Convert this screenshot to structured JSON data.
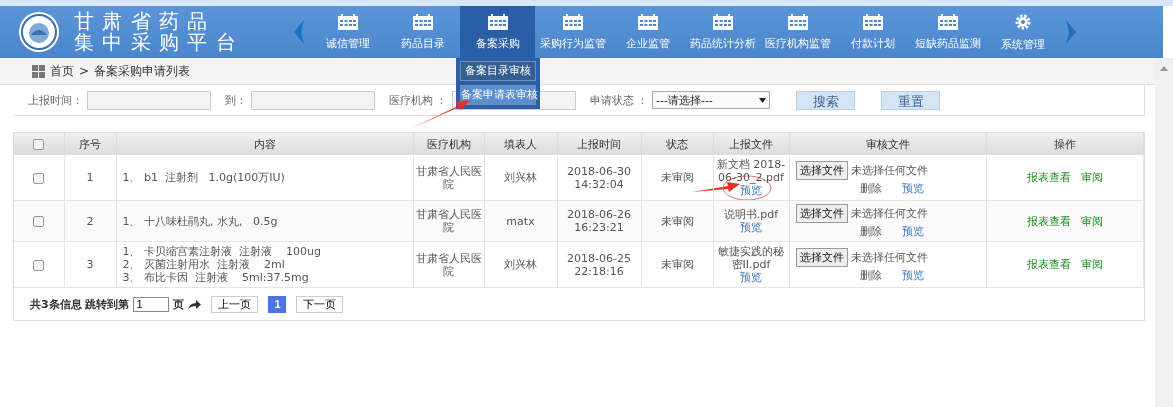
{
  "header": {
    "title_lines": [
      "甘 肃 省 药 品",
      "集 中 采 购 平 台"
    ],
    "nav": [
      {
        "label": "诚信管理",
        "kind": "calendar",
        "selected": false
      },
      {
        "label": "药品目录",
        "kind": "calendar",
        "selected": false
      },
      {
        "label": "备案采购",
        "kind": "calendar",
        "selected": true
      },
      {
        "label": "采购行为监管",
        "kind": "calendar",
        "selected": false
      },
      {
        "label": "企业监管",
        "kind": "calendar",
        "selected": false
      },
      {
        "label": "药品统计分析",
        "kind": "calendar",
        "selected": false
      },
      {
        "label": "医疗机构监管",
        "kind": "calendar",
        "selected": false
      },
      {
        "label": "付款计划",
        "kind": "calendar",
        "selected": false
      },
      {
        "label": "短缺药品监测",
        "kind": "calendar",
        "selected": false
      },
      {
        "label": "系统管理",
        "kind": "gear",
        "selected": false
      }
    ],
    "submenu": [
      {
        "label": "备案目录审核",
        "selected": false
      },
      {
        "label": "备案申请表审核",
        "selected": true
      }
    ]
  },
  "breadcrumb": {
    "home": "首页",
    "separator": ">",
    "current": "备案采购申请列表"
  },
  "filters": [
    {
      "label": "上报时间：",
      "kind": "text"
    },
    {
      "label": "到：",
      "kind": "text"
    },
    {
      "label": "医疗机构 ：",
      "kind": "text"
    },
    {
      "label": "申请状态 ：",
      "kind": "select",
      "value": "---请选择---"
    }
  ],
  "filter_buttons": [
    "搜索",
    "重置"
  ],
  "table": {
    "all_checked": false,
    "columns": [
      "序号",
      "内容",
      "医疗机构",
      "填表人",
      "上报时间",
      "状态",
      "上报文件",
      "审核文件",
      "操作"
    ],
    "rows": [
      {
        "checked": false,
        "seq": "1",
        "content": [
          "1、 b1  注射剂   1.0g(100万IU)"
        ],
        "org": "甘肃省人民医院",
        "filler": "刘兴林",
        "time": [
          "2018-06-30",
          "14:32:04"
        ],
        "status": "未审阅",
        "file": "新文档 2018-06-30_2.pdf",
        "file_preview": "预览",
        "choose": "选择文件",
        "no_file": "未选择任何文件",
        "delete": "删除",
        "review_preview": "预览",
        "actions": [
          "报表查看",
          "审阅"
        ]
      },
      {
        "checked": false,
        "seq": "2",
        "content": [
          "1、 十八味杜鹃丸, 水丸,   0.5g"
        ],
        "org": "甘肃省人民医院",
        "filler": "matx",
        "time": [
          "2018-06-26",
          "16:23:21"
        ],
        "status": "未审阅",
        "file": "说明书.pdf",
        "file_preview": "预览",
        "choose": "选择文件",
        "no_file": "未选择任何文件",
        "delete": "删除",
        "review_preview": "预览",
        "actions": [
          "报表查看",
          "审阅"
        ]
      },
      {
        "checked": false,
        "seq": "3",
        "content": [
          "1、 卡贝缩宫素注射液  注射液    100ug",
          "2、 灭菌注射用水  注射液    2ml",
          "3、 布比卡因  注射液    5ml:37.5mg"
        ],
        "org": "甘肃省人民医院",
        "filler": "刘兴林",
        "time": [
          "2018-06-25",
          "22:18:16"
        ],
        "status": "未审阅",
        "file": "敏捷实践的秘密II.pdf",
        "file_preview": "预览",
        "choose": "选择文件",
        "no_file": "未选择任何文件",
        "delete": "删除",
        "review_preview": "预览",
        "actions": [
          "报表查看",
          "审阅"
        ]
      }
    ]
  },
  "pager": {
    "info": "共3条信息 跳转到第",
    "page_input": "1",
    "page_word": "页",
    "prev": "上一页",
    "pages": [
      {
        "label": "1",
        "selected": true
      }
    ],
    "next": "下一页"
  }
}
